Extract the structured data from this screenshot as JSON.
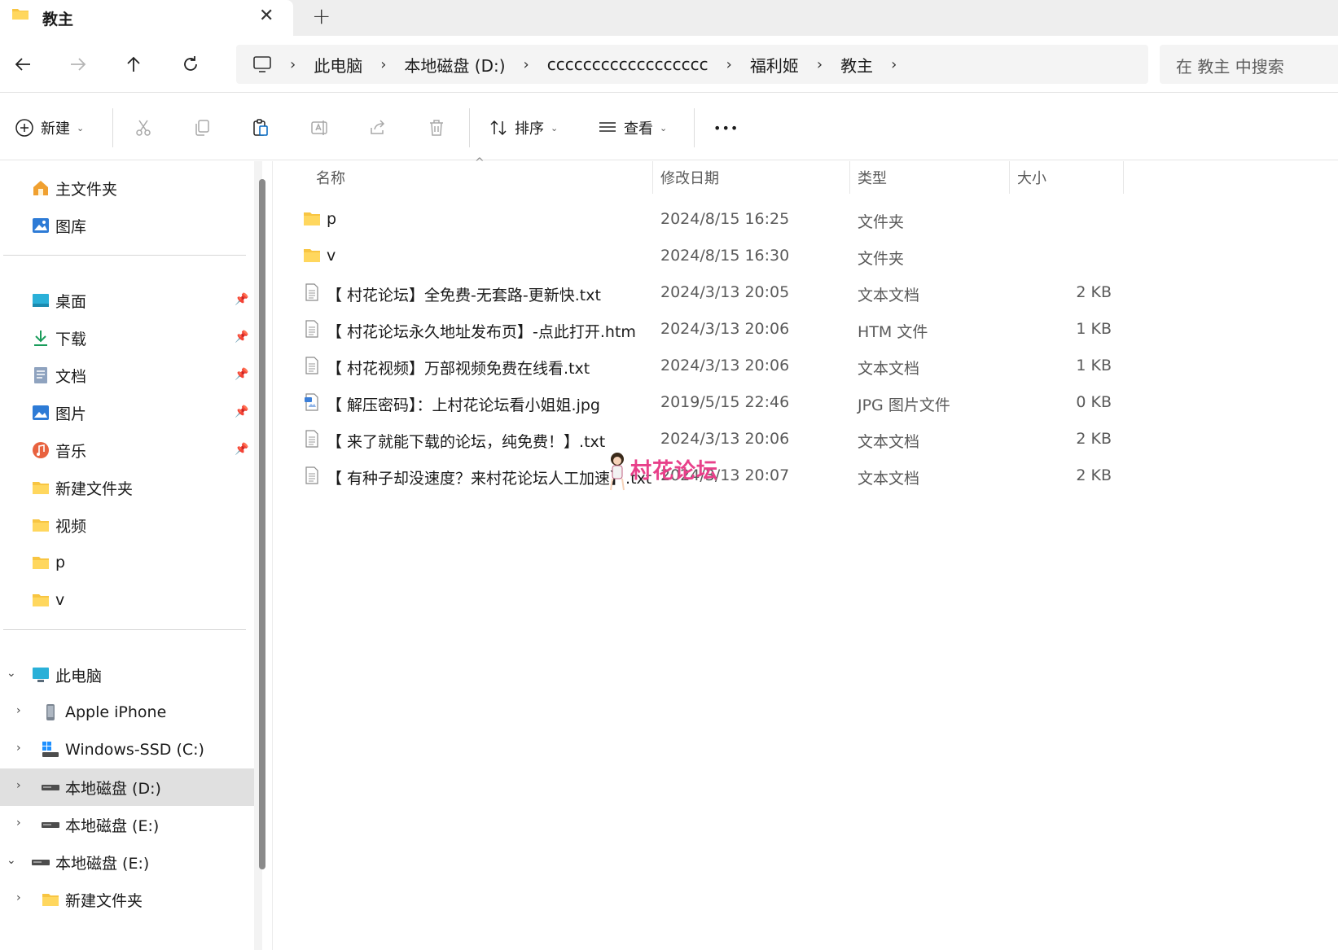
{
  "tab": {
    "title": "教主",
    "close": "✕",
    "add": "+"
  },
  "nav": {
    "back": "←",
    "forward": "→",
    "up": "↑",
    "refresh": "⟳"
  },
  "address": {
    "crumbs": [
      "此电脑",
      "本地磁盘 (D:)",
      "cccccccccccccccccc",
      "福利姬",
      "教主"
    ],
    "separator": "›"
  },
  "search": {
    "placeholder": "在 教主 中搜索"
  },
  "command_bar": {
    "new_label": "新建",
    "sort_label": "排序",
    "view_label": "查看",
    "more_label": "•••"
  },
  "sidebar": {
    "quick": [
      {
        "label": "主文件夹",
        "icon": "home-icon"
      },
      {
        "label": "图库",
        "icon": "gallery-icon"
      }
    ],
    "pinned": [
      {
        "label": "桌面",
        "icon": "desktop-icon",
        "pinned": true
      },
      {
        "label": "下载",
        "icon": "download-icon",
        "pinned": true
      },
      {
        "label": "文档",
        "icon": "documents-icon",
        "pinned": true
      },
      {
        "label": "图片",
        "icon": "pictures-icon",
        "pinned": true
      },
      {
        "label": "音乐",
        "icon": "music-icon",
        "pinned": true
      },
      {
        "label": "新建文件夹",
        "icon": "folder-icon",
        "pinned": false
      },
      {
        "label": "视频",
        "icon": "folder-icon",
        "pinned": false
      },
      {
        "label": "p",
        "icon": "folder-icon",
        "pinned": false
      },
      {
        "label": "v",
        "icon": "folder-icon",
        "pinned": false
      }
    ],
    "tree": [
      {
        "label": "此电脑",
        "icon": "this-pc-icon",
        "expanded": true
      },
      {
        "label": "Apple iPhone",
        "icon": "phone-icon"
      },
      {
        "label": "Windows-SSD (C:)",
        "icon": "windows-drive-icon"
      },
      {
        "label": "本地磁盘 (D:)",
        "icon": "drive-icon",
        "selected": true
      },
      {
        "label": "本地磁盘 (E:)",
        "icon": "drive-icon"
      },
      {
        "label": "本地磁盘 (E:)",
        "icon": "drive-icon",
        "expanded": true
      },
      {
        "label": "新建文件夹",
        "icon": "folder-icon"
      }
    ]
  },
  "columns": {
    "name": "名称",
    "date": "修改日期",
    "type": "类型",
    "size": "大小"
  },
  "files": [
    {
      "name": "p",
      "date": "2024/8/15 16:25",
      "type": "文件夹",
      "size": "",
      "icon": "folder-icon"
    },
    {
      "name": "v",
      "date": "2024/8/15 16:30",
      "type": "文件夹",
      "size": "",
      "icon": "folder-icon"
    },
    {
      "name": "【 村花论坛】全免费-无套路-更新快.txt",
      "date": "2024/3/13 20:05",
      "type": "文本文档",
      "size": "2 KB",
      "icon": "text-file-icon"
    },
    {
      "name": "【 村花论坛永久地址发布页】-点此打开.htm",
      "date": "2024/3/13 20:06",
      "type": "HTM 文件",
      "size": "1 KB",
      "icon": "text-file-icon"
    },
    {
      "name": "【 村花视频】万部视频免费在线看.txt",
      "date": "2024/3/13 20:06",
      "type": "文本文档",
      "size": "1 KB",
      "icon": "text-file-icon"
    },
    {
      "name": "【 解压密码】：上村花论坛看小姐姐.jpg",
      "date": "2019/5/15 22:46",
      "type": "JPG 图片文件",
      "size": "0 KB",
      "icon": "image-file-icon"
    },
    {
      "name": "【 来了就能下载的论坛，纯免费！】.txt",
      "date": "2024/3/13 20:06",
      "type": "文本文档",
      "size": "2 KB",
      "icon": "text-file-icon"
    },
    {
      "name": "【 有种子却没速度？来村花论坛人工加速】.txt",
      "date": "2024/3/13 20:07",
      "type": "文本文档",
      "size": "2 KB",
      "icon": "text-file-icon"
    }
  ],
  "watermark": {
    "text": "村花论坛"
  },
  "colors": {
    "accent": "#0067c0",
    "folder": "#f8c542",
    "selected_bg": "#e0e0e0"
  }
}
